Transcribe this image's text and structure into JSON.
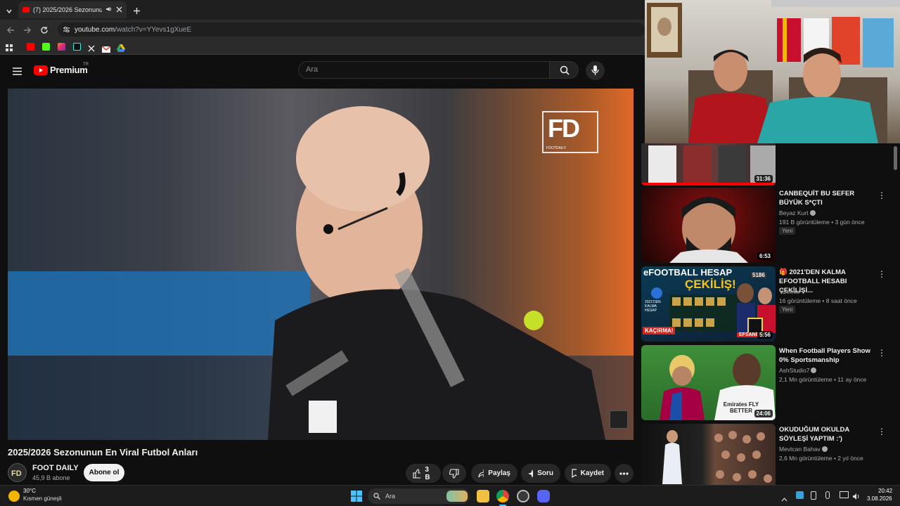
{
  "browser": {
    "tab_title": "(7) 2025/2026 Sezonunun E",
    "url_host": "youtube.com",
    "url_path": "/watch?v=YYevs1gXueE"
  },
  "header": {
    "logo_text": "Premium",
    "logo_region": "TR",
    "search_placeholder": "Ara"
  },
  "video": {
    "title": "2025/2026 Sezonunun En Viral Futbol Anları",
    "watermark": "FD",
    "watermark_sub": "FOOTDAILY"
  },
  "channel": {
    "name": "FOOT DAILY",
    "subscribers": "45,9 B abone",
    "subscribe_label": "Abone ol"
  },
  "actions": {
    "like_count": "3 B",
    "share_label": "Paylaş",
    "ask_label": "Soru",
    "save_label": "Kaydet"
  },
  "recommendations": [
    {
      "title": "",
      "channel": "",
      "meta": "",
      "duration": "31:36",
      "badge": ""
    },
    {
      "title": "CANBEQUİT BU SEFER BÜYÜK S*ÇTI",
      "channel": "Beyaz Kurt",
      "meta": "191 B görüntüleme • 3 gün önce",
      "duration": "6:53",
      "badge": "Yeni"
    },
    {
      "title": "🎁 2021'DEN KALMA EFOOTBALL HESABI ÇEKİLİŞİ...",
      "channel": "YZeeko",
      "meta": "16 görüntüleme • 8 saat önce",
      "duration": "5:56",
      "badge": "Yeni"
    },
    {
      "title": "When Football Players Show 0% Sportsmanship",
      "channel": "AshStudio7",
      "meta": "2,1 Mn görüntüleme • 11 ay önce",
      "duration": "24:06",
      "badge": ""
    },
    {
      "title": "OKUDUĞUM OKULDA SÖYLEŞİ YAPTIM :')",
      "channel": "Mevtcan Bahav",
      "meta": "2,6 Mn görüntüleme • 2 yıl önce",
      "duration": "",
      "badge": ""
    }
  ],
  "thumb_text": {
    "efootball_line1": "eFOOTBALL HESAP",
    "efootball_line2": "ÇEKİLİŞ!",
    "efootball_tag": "KAÇIRMA!",
    "efootball_tag2": "EFSANE",
    "efootball_small": "2021'DEN KALMA HESAP",
    "efootball_num": "5186",
    "jersey_text": "Emirates FLY BETTER"
  },
  "taskbar": {
    "temperature": "30°C",
    "weather": "Kısmen güneşli",
    "search_label": "Ara",
    "time": "20:42",
    "date": "3.08.2026"
  },
  "colors": {
    "yt_red": "#ff0000",
    "background": "#0f0f0f",
    "pill": "#272727"
  }
}
